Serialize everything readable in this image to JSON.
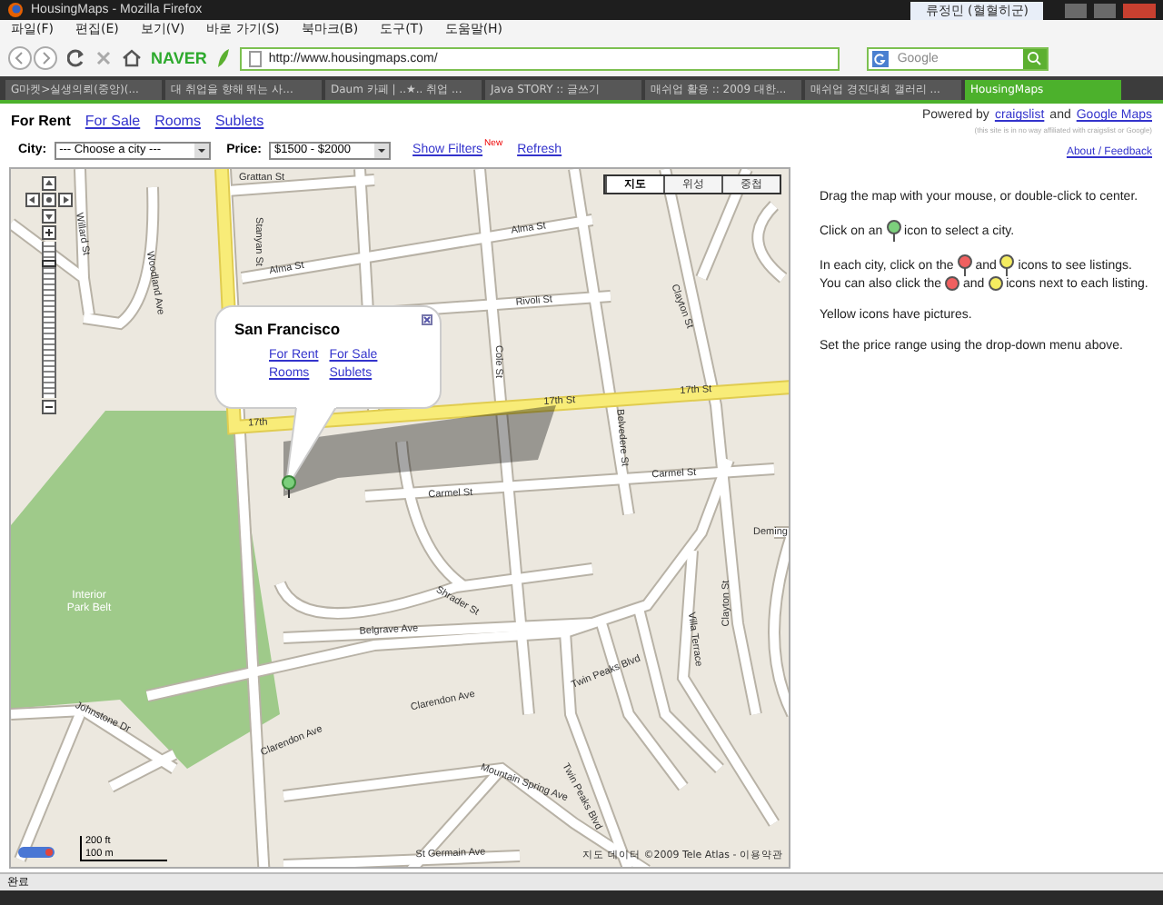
{
  "window": {
    "title": "HousingMaps - Mozilla Firefox",
    "user": "류정민 (혈혈히군)"
  },
  "menu": [
    "파일(F)",
    "편집(E)",
    "보기(V)",
    "바로 가기(S)",
    "북마크(B)",
    "도구(T)",
    "도움말(H)"
  ],
  "toolbar": {
    "brand": "NAVER",
    "url": "http://www.housingmaps.com/",
    "search_placeholder": "Google"
  },
  "tabs": [
    {
      "label": "G마켓>실생의뢰(중앙)(...",
      "selected": false
    },
    {
      "label": "대 취업을 향해 뛰는 사...",
      "selected": false
    },
    {
      "label": "Daum 카페 | ..★.. 취업 ...",
      "selected": false
    },
    {
      "label": "Java STORY :: 글쓰기",
      "selected": false
    },
    {
      "label": "매쉬업 활용 :: 2009 대한...",
      "selected": false
    },
    {
      "label": "매쉬업 경진대회 갤러리 ...",
      "selected": false
    },
    {
      "label": "HousingMaps",
      "selected": true
    }
  ],
  "categories": [
    {
      "label": "For Rent",
      "selected": true
    },
    {
      "label": "For Sale",
      "selected": false
    },
    {
      "label": "Rooms",
      "selected": false
    },
    {
      "label": "Sublets",
      "selected": false
    }
  ],
  "powered": {
    "text": "Powered by",
    "link1": "craigslist",
    "and": "and",
    "link2": "Google Maps",
    "disclaimer": "(this site is in no way affiliated with craigslist or Google)",
    "about": "About / Feedback"
  },
  "filters": {
    "city_label": "City:",
    "city_value": "--- Choose a city ---",
    "price_label": "Price:",
    "price_value": "$1500 - $2000",
    "show_filters": "Show Filters",
    "new_badge": "New",
    "refresh": "Refresh"
  },
  "map": {
    "types": [
      {
        "label": "지도",
        "selected": true
      },
      {
        "label": "위성",
        "selected": false
      },
      {
        "label": "중첩",
        "selected": false
      }
    ],
    "zoom_slider": {
      "level": 0.88
    },
    "street_labels": [
      "Grattan St",
      "Alma St",
      "Alma St",
      "Rivoli St",
      "Cole St",
      "17th St",
      "17th St",
      "17th",
      "Carmel St",
      "Carmel St",
      "Belvedere St",
      "Clayton St",
      "Willard St",
      "Woodland Ave",
      "Stanyan St",
      "Shrader St",
      "Belgrave Ave",
      "Clarendon Ave",
      "Clarendon Ave",
      "Twin Peaks Blvd",
      "Johnstone Dr",
      "Mountain Spring Ave",
      "St Germain Ave",
      "Deming",
      "Villa Terrace",
      "Clayton St",
      "Twin Peaks Blvd"
    ],
    "park_label": [
      "Interior",
      "Park Belt"
    ],
    "scale": [
      "200 ft",
      "100 m"
    ],
    "copyright": "지도 데이터 ©2009 Tele Atlas - 이용약관",
    "info_window": {
      "title": "San Francisco",
      "links": [
        "For Rent",
        "For Sale",
        "Rooms",
        "Sublets"
      ]
    }
  },
  "help": [
    [
      {
        "kind": "text",
        "text": "Drag the map with your mouse, or double-click to center."
      }
    ],
    [
      {
        "kind": "text",
        "text": "Click on an"
      },
      {
        "kind": "pin",
        "color": "#7ccf7c"
      },
      {
        "kind": "text",
        "text": "icon to select a city."
      }
    ],
    [
      {
        "kind": "text",
        "text": "In each city, click on the"
      },
      {
        "kind": "pin",
        "color": "#f06060"
      },
      {
        "kind": "text",
        "text": "and"
      },
      {
        "kind": "pin",
        "color": "#f4ec60"
      },
      {
        "kind": "text",
        "text": "icons to see listings."
      },
      {
        "kind": "text",
        "text": "You can also click the"
      },
      {
        "kind": "dot",
        "color": "#f06060"
      },
      {
        "kind": "text",
        "text": "and"
      },
      {
        "kind": "dot",
        "color": "#f4ec60"
      },
      {
        "kind": "text",
        "text": "icons next to each"
      },
      {
        "kind": "text",
        "text": "listing."
      }
    ],
    [
      {
        "kind": "text",
        "text": "Yellow icons have pictures."
      }
    ],
    [
      {
        "kind": "text",
        "text": "Set the price range using the drop-down menu above."
      }
    ]
  ],
  "status_bar": "완료"
}
